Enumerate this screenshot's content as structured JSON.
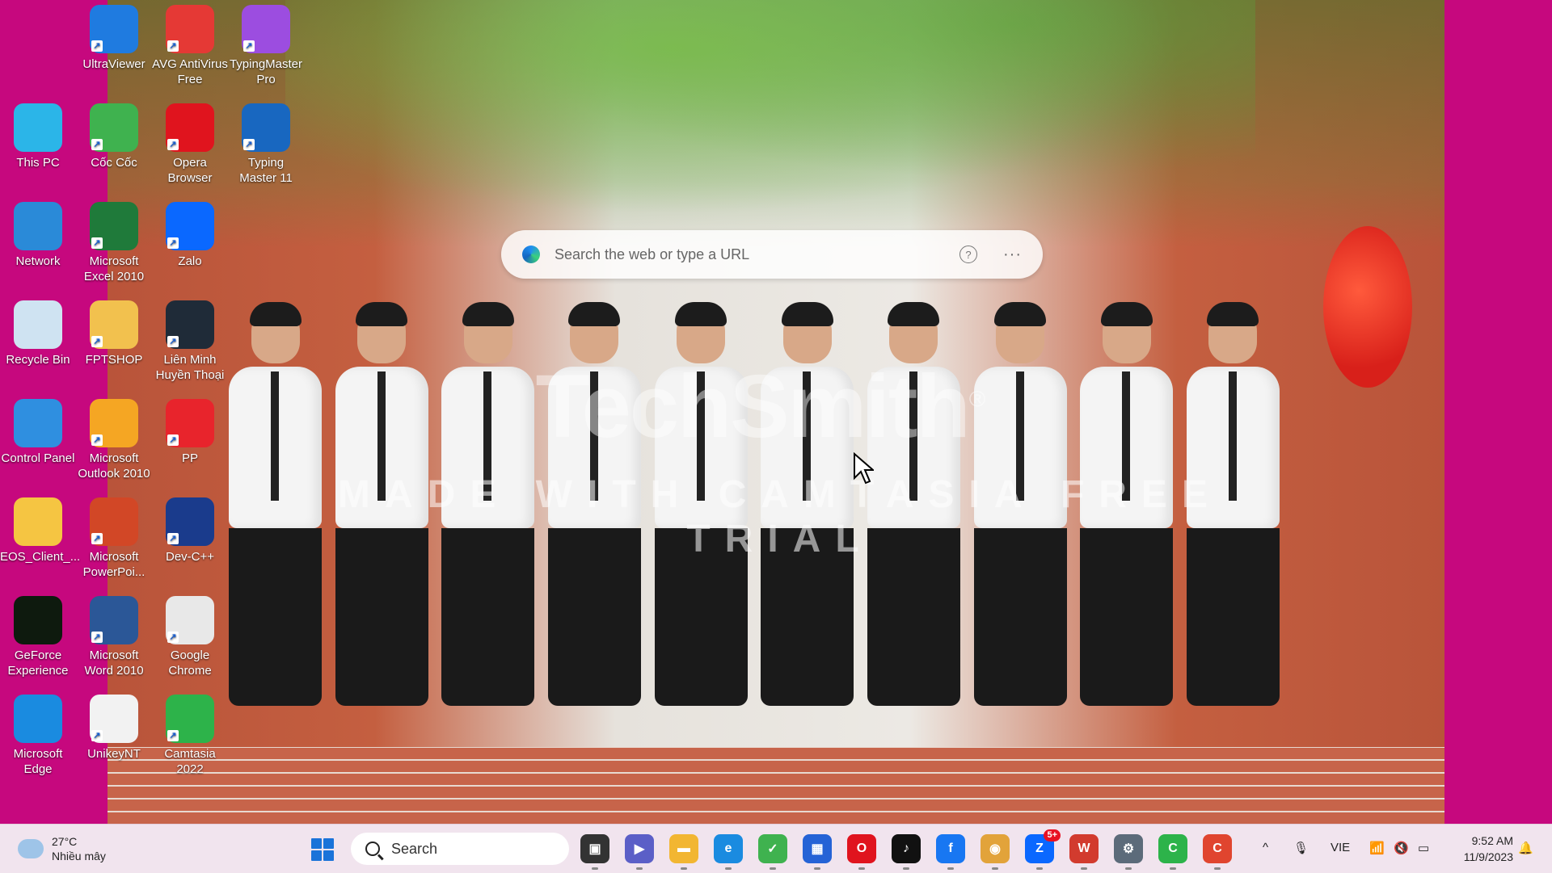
{
  "desktop": {
    "background_color": "#c6087e",
    "icons": [
      {
        "label": "UltraViewer",
        "icon": "ultraviewer-icon",
        "color": "#1f7be0"
      },
      {
        "label": "AVG AntiVirus Free",
        "icon": "avg-antivirus-icon",
        "color": "#e53935"
      },
      {
        "label": "TypingMaster Pro",
        "icon": "typingmaster-pro-icon",
        "color": "#9c4de0"
      },
      {
        "label": "This PC",
        "icon": "monitor-icon",
        "color": "#2bb5e8"
      },
      {
        "label": "Cốc Cốc",
        "icon": "coccoc-icon",
        "color": "#3fb24f"
      },
      {
        "label": "Opera Browser",
        "icon": "opera-icon",
        "color": "#e0141e"
      },
      {
        "label": "Typing Master 11",
        "icon": "typing-master-icon",
        "color": "#1867c0"
      },
      {
        "label": "Network",
        "icon": "network-globe-icon",
        "color": "#2a8ad8"
      },
      {
        "label": "Microsoft Excel 2010",
        "icon": "excel-icon",
        "color": "#1f7a3a"
      },
      {
        "label": "Zalo",
        "icon": "zalo-icon",
        "color": "#0a68ff"
      },
      {
        "label": "Recycle Bin",
        "icon": "recycle-bin-icon",
        "color": "#cfe3f2"
      },
      {
        "label": "FPTSHOP",
        "icon": "folder-icon",
        "color": "#f2c14e"
      },
      {
        "label": "Liên Minh Huyền Thoại",
        "icon": "league-icon",
        "color": "#1f2b38"
      },
      {
        "label": "Control Panel",
        "icon": "control-panel-icon",
        "color": "#2f8fe0"
      },
      {
        "label": "Microsoft Outlook 2010",
        "icon": "outlook-icon",
        "color": "#f5a623"
      },
      {
        "label": "PP",
        "icon": "riot-icon",
        "color": "#e8242c"
      },
      {
        "label": "EOS_Client_...",
        "icon": "folder-icon",
        "color": "#f5c542"
      },
      {
        "label": "Microsoft PowerPoi...",
        "icon": "powerpoint-icon",
        "color": "#d24726"
      },
      {
        "label": "Dev-C++",
        "icon": "devcpp-icon",
        "color": "#1a3b8c"
      },
      {
        "label": "GeForce Experience",
        "icon": "nvidia-icon",
        "color": "#0e1a0e"
      },
      {
        "label": "Microsoft Word 2010",
        "icon": "word-icon",
        "color": "#2b5797"
      },
      {
        "label": "Google Chrome",
        "icon": "chrome-icon",
        "color": "#e8e8e8"
      },
      {
        "label": "Microsoft Edge",
        "icon": "edge-icon",
        "color": "#1a8be0"
      },
      {
        "label": "UnikeyNT",
        "icon": "unikey-icon",
        "color": "#f2f2f2"
      },
      {
        "label": "Camtasia 2022",
        "icon": "camtasia-icon",
        "color": "#2db34a"
      }
    ]
  },
  "browser_search": {
    "placeholder": "Search the web or type a URL",
    "help": "?",
    "more": "···"
  },
  "watermark": {
    "logo": "TechSmith",
    "mark": "®",
    "text": "MADE WITH CAMTASIA FREE TRIAL"
  },
  "taskbar": {
    "weather": {
      "temp": "27°C",
      "condition": "Nhiều mây"
    },
    "search_label": "Search",
    "apps": [
      {
        "name": "task-view",
        "glyph": "▣",
        "color": "#333333"
      },
      {
        "name": "teams",
        "glyph": "▶",
        "color": "#5b5fc7"
      },
      {
        "name": "file-explorer",
        "glyph": "▬",
        "color": "#f2b632"
      },
      {
        "name": "edge",
        "glyph": "e",
        "color": "#1a8be0"
      },
      {
        "name": "coccoc",
        "glyph": "✓",
        "color": "#3fb24f"
      },
      {
        "name": "ms-store",
        "glyph": "▦",
        "color": "#2563d6"
      },
      {
        "name": "opera",
        "glyph": "O",
        "color": "#e0141e"
      },
      {
        "name": "tiktok",
        "glyph": "♪",
        "color": "#111111"
      },
      {
        "name": "facebook",
        "glyph": "f",
        "color": "#1877f2"
      },
      {
        "name": "chrome",
        "glyph": "◉",
        "color": "#e2a33a"
      },
      {
        "name": "zalo",
        "glyph": "Z",
        "color": "#0a68ff",
        "badge": "5+"
      },
      {
        "name": "wps",
        "glyph": "W",
        "color": "#d23b2e"
      },
      {
        "name": "settings",
        "glyph": "⚙",
        "color": "#5c6b7a"
      },
      {
        "name": "camtasia",
        "glyph": "C",
        "color": "#2db34a"
      },
      {
        "name": "camtasia-recorder",
        "glyph": "C",
        "color": "#e0452f"
      }
    ],
    "tray": {
      "chevron": "^",
      "mic": "🎙",
      "language": "VIE",
      "wifi": "📶",
      "volume": "🔇",
      "battery": "▭"
    },
    "clock": {
      "time": "9:52 AM",
      "date": "11/9/2023"
    }
  }
}
